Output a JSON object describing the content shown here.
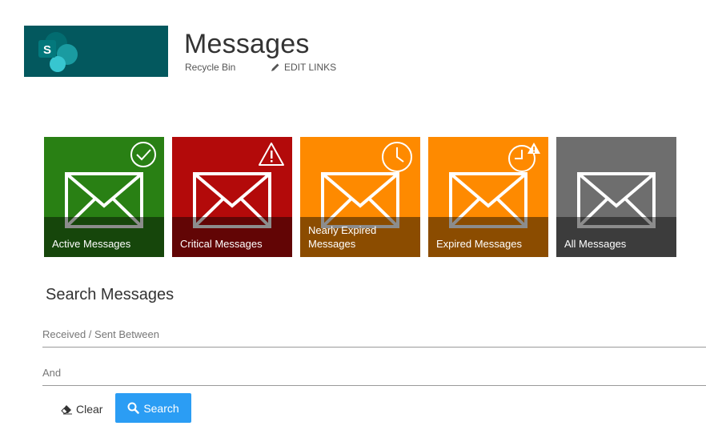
{
  "header": {
    "title": "Messages",
    "nav_link": "Recycle Bin",
    "edit_links_label": "EDIT LINKS"
  },
  "tiles": [
    {
      "label": "Active Messages",
      "color": "#298014",
      "icon": "check-circle-icon"
    },
    {
      "label": "Critical Messages",
      "color": "#b30a0a",
      "icon": "warning-icon"
    },
    {
      "label": "Nearly Expired Messages",
      "color": "#fe8a00",
      "icon": "clock-icon"
    },
    {
      "label": "Expired Messages",
      "color": "#fe8a00",
      "icon": "clock-warning-icon"
    },
    {
      "label": "All Messages",
      "color": "#6e6e6e",
      "icon": "envelope-icon"
    }
  ],
  "search": {
    "heading": "Search Messages",
    "from_placeholder": "Received / Sent Between",
    "to_placeholder": "And",
    "clear_label": "Clear",
    "search_label": "Search",
    "search_button_color": "#2b9df4"
  },
  "colors": {
    "logo_background": "#03585e"
  }
}
